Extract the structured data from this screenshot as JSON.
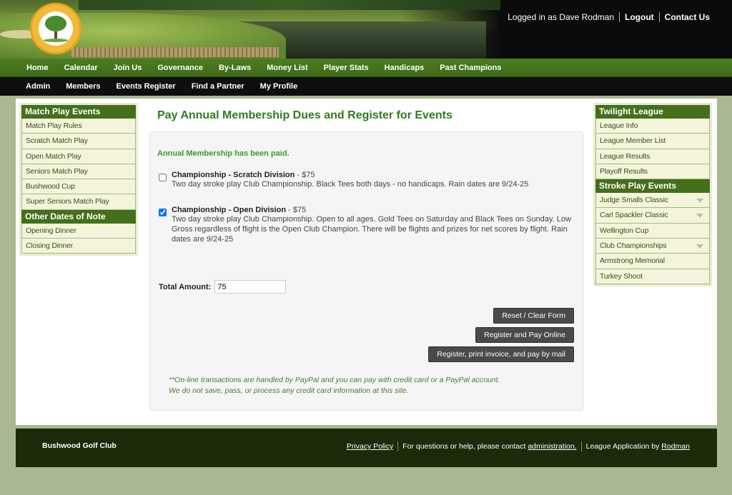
{
  "header": {
    "logo_alt_text": "Bushwood Country Club",
    "logged_in_text": "Logged in as Dave Rodman",
    "logout_label": "Logout",
    "contact_label": "Contact Us"
  },
  "nav_primary": [
    "Home",
    "Calendar",
    "Join Us",
    "Governance",
    "By-Laws",
    "Money List",
    "Player Stats",
    "Handicaps",
    "Past Champions"
  ],
  "nav_secondary": [
    "Admin",
    "Members",
    "Events Register",
    "Find a Partner",
    "My Profile"
  ],
  "sidebar_left": {
    "sections": [
      {
        "title": "Match Play Events",
        "items": [
          "Match Play Rules",
          "Scratch Match Play",
          "Open Match Play",
          "Seniors Match Play",
          "Bushwood Cup",
          "Super Seniors Match Play"
        ]
      },
      {
        "title": "Other Dates of Note",
        "items": [
          "Opening Dinner",
          "Closing Dinner"
        ]
      }
    ]
  },
  "sidebar_right": {
    "sections": [
      {
        "title": "Twilight League",
        "items": [
          "League Info",
          "League Member List",
          "League Results",
          "Playoff Results"
        ]
      },
      {
        "title": "Stroke Play Events",
        "items": [
          "Judge Smalls Classic",
          "Carl Spackler Classic",
          "Wellington Cup",
          "Club Championships",
          "Armstrong Memorial",
          "Turkey Shoot"
        ]
      }
    ]
  },
  "main": {
    "page_title": "Pay Annual Membership Dues and Register for Events",
    "paid_message": "Annual Membership has been paid.",
    "events": [
      {
        "title": "Championship - Scratch Division",
        "price": " - $75",
        "desc": "Two day stroke play Club Championship. Black Tees both days - no handicaps. Rain dates are 9/24-25",
        "checked": false
      },
      {
        "title": "Championship - Open Division",
        "price": " - $75",
        "desc": "Two day stroke play Club Championship. Open to all ages. Gold Tees on Saturday and Black Tees on Sunday. Low Gross regardless of flight is the Open Club Champion. There will be flights and prizes for net scores by flight. Rain dates are 9/24-25",
        "checked": true
      }
    ],
    "total_label": "Total Amount:",
    "total_value": "75",
    "buttons": {
      "reset": "Reset / Clear Form",
      "pay_online": "Register and Pay Online",
      "pay_mail": "Register, print invoice, and pay by mail"
    },
    "note_line1": "**On-line transactions are handled by PayPal and you can pay with credit card or a PayPal account.",
    "note_line2": "We do not save, pass, or process any credit card information at this site."
  },
  "footer": {
    "brand": "Bushwood Golf Club",
    "privacy": "Privacy Policy",
    "help_text": "For questions or help, please contact ",
    "help_link": "administration.",
    "app_text": "League Application by ",
    "app_link": "Rodman"
  },
  "colors": {
    "nav_green": "#3e6a17",
    "sidebar_head": "#446f1b",
    "title_green": "#2e7d1e",
    "footer_bg": "#1b2a09"
  }
}
